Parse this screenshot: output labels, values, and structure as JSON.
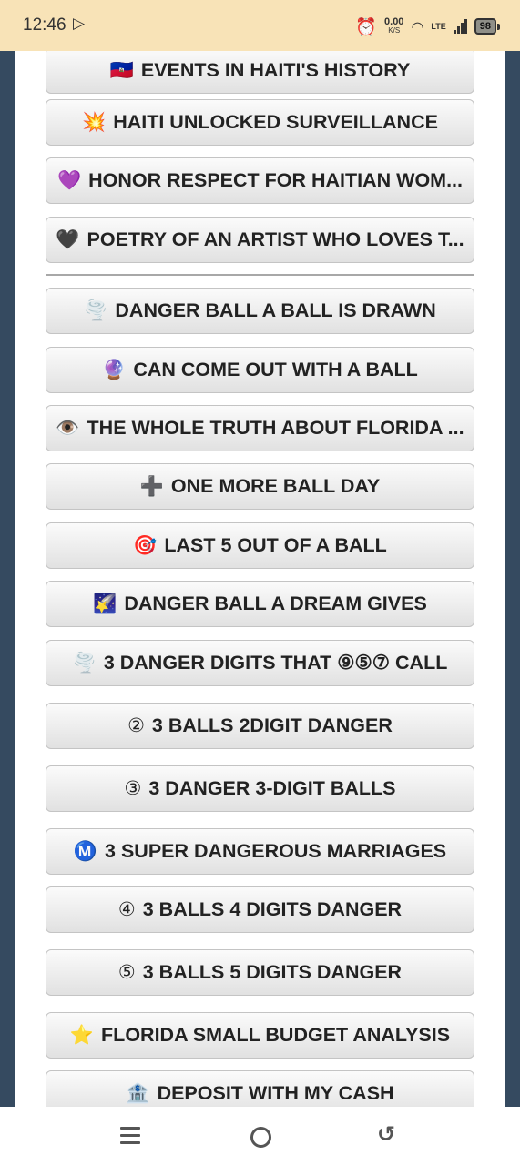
{
  "status_bar": {
    "time": "12:46",
    "left_icon": "play-store-icon",
    "speed_value": "0.00",
    "speed_unit": "K/S",
    "network": "LTE",
    "battery": "98"
  },
  "menu": {
    "items": [
      {
        "icon": "haiti-flag-icon",
        "glyph": "🇭🇹",
        "label": "EVENTS IN HAITI'S HISTORY"
      },
      {
        "icon": "collision-icon",
        "glyph": "💥",
        "label": "HAITI UNLOCKED SURVEILLANCE"
      },
      {
        "icon": "purple-heart-icon",
        "glyph": "💜",
        "label": "HONOR RESPECT FOR HAITIAN WOM..."
      },
      {
        "icon": "black-heart-icon",
        "glyph": "🖤",
        "label": "POETRY OF AN ARTIST WHO LOVES T..."
      },
      {
        "icon": "tornado-icon",
        "glyph": "🌪️",
        "label": "DANGER BALL A BALL IS DRAWN"
      },
      {
        "icon": "crystal-ball-icon",
        "glyph": "🔮",
        "label": "CAN COME OUT WITH A BALL"
      },
      {
        "icon": "eye-icon",
        "glyph": "👁️",
        "label": "THE WHOLE TRUTH ABOUT FLORIDA ..."
      },
      {
        "icon": "plus-icon",
        "glyph": "➕",
        "label": "ONE MORE BALL DAY"
      },
      {
        "icon": "target-icon",
        "glyph": "🎯",
        "label": "LAST 5 OUT OF A BALL"
      },
      {
        "icon": "shooting-star-icon",
        "glyph": "🌠",
        "label": "DANGER BALL A DREAM GIVES"
      },
      {
        "icon": "tornado-icon",
        "glyph": "🌪️",
        "label": "3 DANGER DIGITS THAT ⑨⑤⑦ CALL"
      },
      {
        "icon": "circled-2-icon",
        "glyph": "②",
        "label": "3 BALLS 2DIGIT DANGER"
      },
      {
        "icon": "circled-3-icon",
        "glyph": "③",
        "label": "3 DANGER 3-DIGIT BALLS"
      },
      {
        "icon": "circled-m-icon",
        "glyph": "Ⓜ️",
        "label": "3 SUPER DANGEROUS MARRIAGES"
      },
      {
        "icon": "circled-4-icon",
        "glyph": "④",
        "label": "3 BALLS 4 DIGITS DANGER"
      },
      {
        "icon": "circled-5-icon",
        "glyph": "⑤",
        "label": "3 BALLS 5 DIGITS DANGER"
      },
      {
        "icon": "star-icon",
        "glyph": "⭐",
        "label": "FLORIDA SMALL BUDGET ANALYSIS"
      },
      {
        "icon": "bank-icon",
        "glyph": "🏦",
        "label": "DEPOSIT WITH MY CASH"
      }
    ]
  },
  "nav_bar": {
    "menu_icon": "menu-icon",
    "home_icon": "home-icon",
    "back_icon": "back-icon"
  }
}
